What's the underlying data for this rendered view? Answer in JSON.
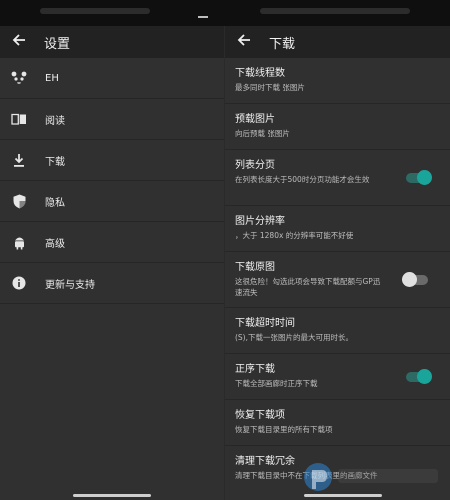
{
  "left_pane": {
    "title": "设置",
    "items": [
      {
        "label": "EH",
        "icon": "panda-icon"
      },
      {
        "label": "阅读",
        "icon": "book-icon"
      },
      {
        "label": "下载",
        "icon": "download-icon"
      },
      {
        "label": "隐私",
        "icon": "shield-icon"
      },
      {
        "label": "高级",
        "icon": "android-icon"
      },
      {
        "label": "更新与支持",
        "icon": "info-icon"
      }
    ]
  },
  "right_pane": {
    "title": "下载",
    "settings": [
      {
        "title": "下载线程数",
        "subtitle": "最多同时下载 张图片"
      },
      {
        "title": "预载图片",
        "subtitle": "向后预载 张图片"
      },
      {
        "title": "列表分页",
        "subtitle": "在列表长度大于500时分页功能才会生效",
        "toggle": true
      },
      {
        "title": "图片分辨率",
        "subtitle": "，大于 1280x 的分辨率可能不好使"
      },
      {
        "title": "下载原图",
        "subtitle": "这很危险！勾选此项会导致下载配额与GP迅速流失",
        "toggle": false
      },
      {
        "title": "下载超时时间",
        "subtitle": "(S),下载一张图片的最大可用时长。"
      },
      {
        "title": "正序下载",
        "subtitle": "下载全部画廊时正序下载",
        "toggle": true
      },
      {
        "title": "恢复下载项",
        "subtitle": "恢复下载目录里的所有下载项"
      },
      {
        "title": "清理下载冗余",
        "subtitle": "清理下载目录中不在下载列表里的画廊文件"
      }
    ]
  },
  "colors": {
    "accent": "#1aa59b",
    "background": "#303030",
    "toolbar": "#222222"
  }
}
